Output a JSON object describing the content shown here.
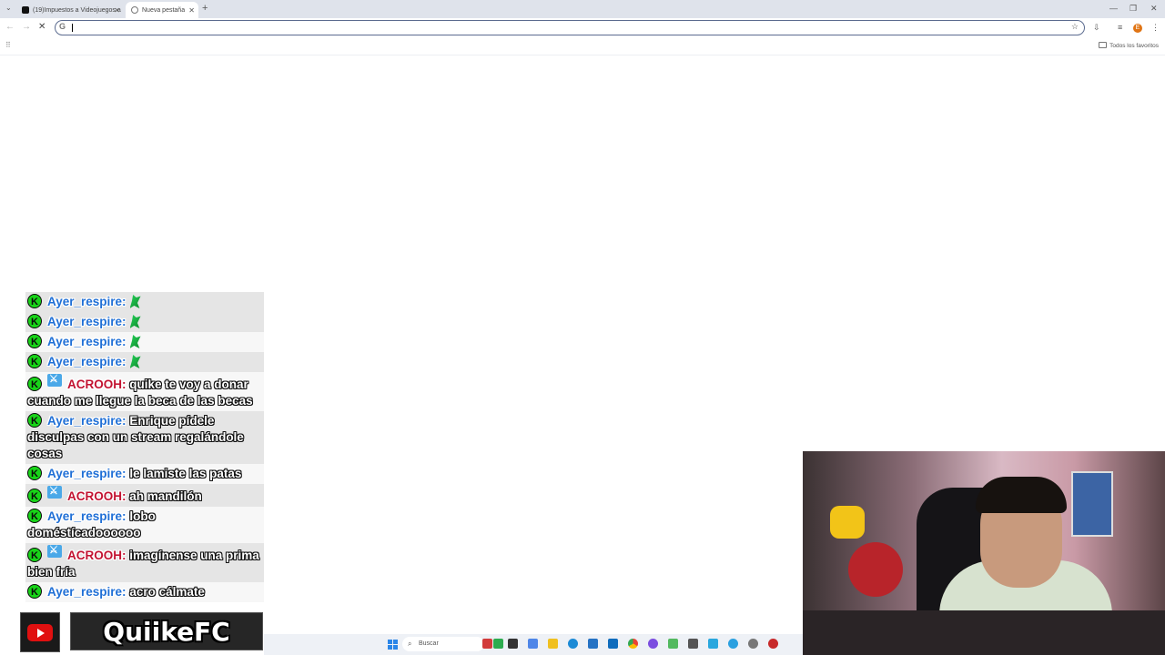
{
  "browser": {
    "tabs": [
      {
        "title": "(19)Impuestos a Videojuegos a",
        "active": false
      },
      {
        "title": "Nueva pestaña",
        "active": true
      }
    ],
    "omnibox": {
      "value": "",
      "placeholder": ""
    },
    "bookmarks": {
      "all_favorites_label": "Todos los favoritos"
    },
    "profile_initial": "E"
  },
  "chat": {
    "messages": [
      {
        "user": "Ayer_respire:",
        "text": "",
        "mod": false,
        "emote": true
      },
      {
        "user": "Ayer_respire:",
        "text": "",
        "mod": false,
        "emote": true
      },
      {
        "user": "Ayer_respire:",
        "text": "",
        "mod": false,
        "emote": true
      },
      {
        "user": "Ayer_respire:",
        "text": "",
        "mod": false,
        "emote": true
      },
      {
        "user": "ACROOH:",
        "text": "quike te voy a donar cuando me llegue la beca de las becas",
        "mod": true,
        "emote": false
      },
      {
        "user": "Ayer_respire:",
        "text": "Enrique pídele disculpas con un stream regalándole cosas",
        "mod": false,
        "emote": false
      },
      {
        "user": "Ayer_respire:",
        "text": "le lamiste las patas",
        "mod": false,
        "emote": false
      },
      {
        "user": "ACROOH:",
        "text": "ah mandilón",
        "mod": true,
        "emote": false
      },
      {
        "user": "Ayer_respire:",
        "text": "lobo doméstícadoooooo",
        "mod": false,
        "emote": false
      },
      {
        "user": "ACROOH:",
        "text": "imagínense una prima bien fría",
        "mod": true,
        "emote": false
      },
      {
        "user": "Ayer_respire:",
        "text": "acro cálmate",
        "mod": false,
        "emote": false
      }
    ]
  },
  "branding": {
    "channel_name": "QuiikeFC",
    "youtube_icon": "youtube-icon"
  },
  "taskbar": {
    "search_placeholder": "Buscar"
  },
  "colors": {
    "accent_green": "#18d418",
    "user_blue": "#1f6fd6",
    "user_red": "#c21230",
    "youtube_red": "#e01010"
  }
}
